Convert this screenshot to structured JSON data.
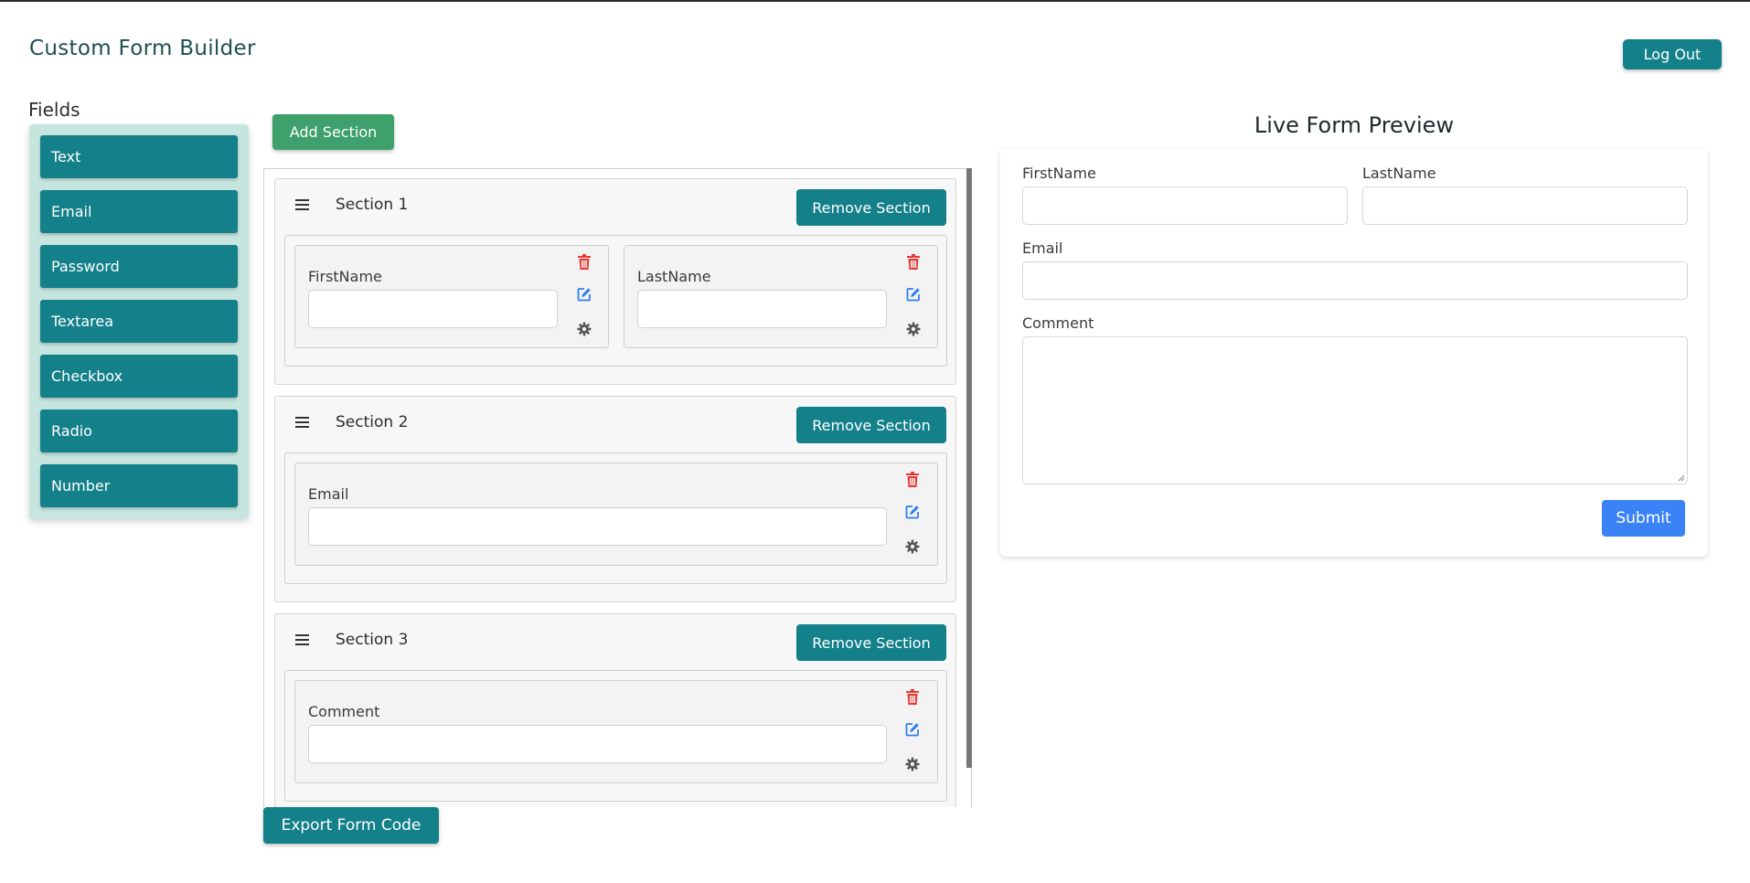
{
  "header": {
    "title": "Custom Form Builder",
    "logout_label": "Log Out"
  },
  "fields_panel": {
    "heading": "Fields",
    "items": [
      {
        "label": "Text"
      },
      {
        "label": "Email"
      },
      {
        "label": "Password"
      },
      {
        "label": "Textarea"
      },
      {
        "label": "Checkbox"
      },
      {
        "label": "Radio"
      },
      {
        "label": "Number"
      }
    ]
  },
  "builder": {
    "add_section_label": "Add Section",
    "remove_section_label": "Remove Section",
    "export_label": "Export Form Code",
    "sections": [
      {
        "title": "Section 1",
        "fields": [
          {
            "label": "FirstName"
          },
          {
            "label": "LastName"
          }
        ]
      },
      {
        "title": "Section 2",
        "fields": [
          {
            "label": "Email"
          }
        ]
      },
      {
        "title": "Section 3",
        "fields": [
          {
            "label": "Comment"
          }
        ]
      }
    ]
  },
  "preview": {
    "heading": "Live Form Preview",
    "fields": [
      {
        "label": "FirstName"
      },
      {
        "label": "LastName"
      },
      {
        "label": "Email"
      },
      {
        "label": "Comment"
      }
    ],
    "submit_label": "Submit"
  },
  "colors": {
    "primary_teal": "#13808a",
    "add_green": "#3ea06a",
    "panel_mint": "#c6e5df",
    "submit_blue": "#3b82f6",
    "delete_red": "#e53935",
    "edit_blue": "#2f80ed",
    "settings_gray": "#555555"
  },
  "icons": {
    "drag": "drag-handle-icon",
    "delete": "trash-icon",
    "edit": "edit-icon",
    "settings": "gear-icon"
  }
}
